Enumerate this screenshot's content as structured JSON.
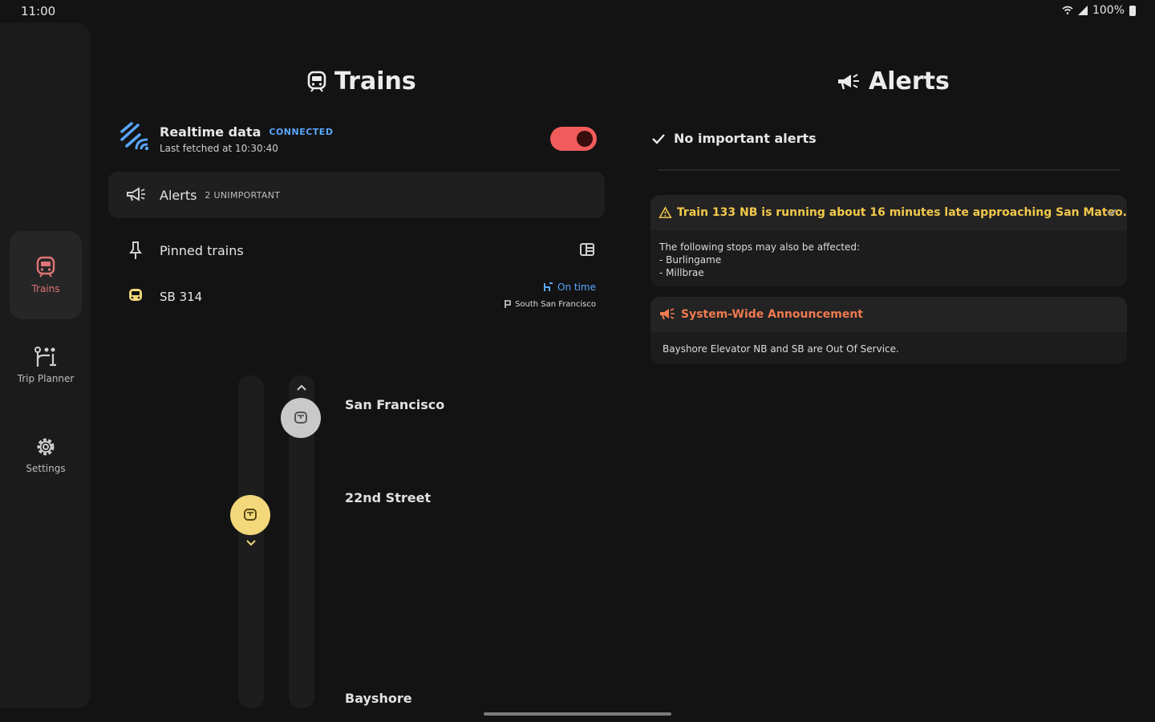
{
  "status": {
    "time": "11:00",
    "battery": "100%"
  },
  "rail": {
    "items": [
      {
        "label": "Trains",
        "icon": "train-icon",
        "active": true
      },
      {
        "label": "Trip Planner",
        "icon": "route-icon",
        "active": false
      },
      {
        "label": "Settings",
        "icon": "gear-icon",
        "active": false
      }
    ]
  },
  "trains": {
    "title": "Trains",
    "realtime": {
      "label": "Realtime data",
      "status": "CONNECTED",
      "fetched": "Last fetched at 10:30:40",
      "enabled": true
    },
    "alerts": {
      "label": "Alerts",
      "count": "2 UNIMPORTANT"
    },
    "pinned": {
      "label": "Pinned trains",
      "train": {
        "name": "SB 314",
        "status": "On time",
        "next": "South San Francisco"
      }
    },
    "stations": [
      "San Francisco",
      "22nd Street",
      "Bayshore"
    ]
  },
  "alerts_panel": {
    "title": "Alerts",
    "summary": "No important alerts",
    "cards": [
      {
        "title": "Train 133 NB is running about 16 minutes late approaching San Mateo.",
        "body_intro": "The following stops may also be affected:",
        "body_items": [
          "- Burlingame",
          "- Millbrae"
        ]
      },
      {
        "title": "System-Wide Announcement",
        "body": "Bayshore Elevator NB and SB are Out Of Service."
      }
    ]
  },
  "colors": {
    "accent_red": "#f25b5b",
    "link_blue": "#5aa6ff",
    "warn_yellow": "#f2c84b",
    "announce_orange": "#f07a50",
    "train_yellow": "#f3d77b"
  }
}
